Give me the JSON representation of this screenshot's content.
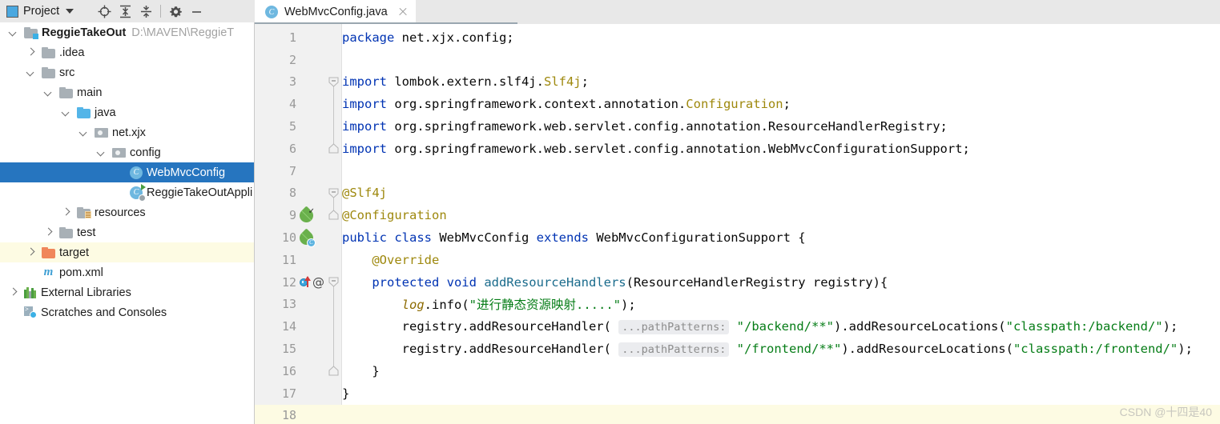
{
  "project_panel": {
    "title": "Project",
    "icons": [
      "project-square-icon",
      "chevron-down-icon",
      "locate-target-icon",
      "expand-all-icon",
      "collapse-all-icon",
      "gear-icon",
      "minimize-icon"
    ],
    "tree": [
      {
        "label": "ReggieTakeOut",
        "path": "D:\\MAVEN\\ReggieT",
        "icon": "folder-module-icon",
        "arrow": "down",
        "indent": 0,
        "bold": true,
        "state": "normal"
      },
      {
        "label": ".idea",
        "path": "",
        "icon": "folder-icon",
        "arrow": "right",
        "indent": 1,
        "bold": false,
        "state": "normal"
      },
      {
        "label": "src",
        "path": "",
        "icon": "folder-icon",
        "arrow": "down",
        "indent": 1,
        "bold": false,
        "state": "normal"
      },
      {
        "label": "main",
        "path": "",
        "icon": "folder-icon",
        "arrow": "down",
        "indent": 2,
        "bold": false,
        "state": "normal"
      },
      {
        "label": "java",
        "path": "",
        "icon": "folder-source-icon",
        "arrow": "down",
        "indent": 3,
        "bold": false,
        "state": "normal"
      },
      {
        "label": "net.xjx",
        "path": "",
        "icon": "package-icon",
        "arrow": "down",
        "indent": 4,
        "bold": false,
        "state": "normal"
      },
      {
        "label": "config",
        "path": "",
        "icon": "package-icon",
        "arrow": "down",
        "indent": 5,
        "bold": false,
        "state": "normal"
      },
      {
        "label": "WebMvcConfig",
        "path": "",
        "icon": "java-class-icon",
        "arrow": "none",
        "indent": 6,
        "bold": false,
        "state": "selected"
      },
      {
        "label": "ReggieTakeOutAppli",
        "path": "",
        "icon": "java-runnable-class-icon",
        "arrow": "none",
        "indent": 6,
        "bold": false,
        "state": "normal"
      },
      {
        "label": "resources",
        "path": "",
        "icon": "folder-resources-icon",
        "arrow": "right",
        "indent": 3,
        "bold": false,
        "state": "normal"
      },
      {
        "label": "test",
        "path": "",
        "icon": "folder-icon",
        "arrow": "right",
        "indent": 2,
        "bold": false,
        "state": "normal"
      },
      {
        "label": "target",
        "path": "",
        "icon": "folder-excluded-icon",
        "arrow": "right",
        "indent": 1,
        "bold": false,
        "state": "highlighted"
      },
      {
        "label": "pom.xml",
        "path": "",
        "icon": "maven-icon",
        "arrow": "none",
        "indent": 1,
        "bold": false,
        "state": "normal"
      },
      {
        "label": "External Libraries",
        "path": "",
        "icon": "libraries-icon",
        "arrow": "right",
        "indent": 0,
        "bold": false,
        "state": "normal"
      },
      {
        "label": "Scratches and Consoles",
        "path": "",
        "icon": "scratches-icon",
        "arrow": "none",
        "indent": 0,
        "bold": false,
        "state": "normal"
      }
    ]
  },
  "editor": {
    "tab": {
      "label": "WebMvcConfig.java",
      "icon": "java-class-icon",
      "close_icon": "close-icon"
    },
    "current_line": 18,
    "lines": [
      {
        "num": "1",
        "gutter": [],
        "fold": "none",
        "tokens": [
          {
            "t": "package ",
            "c": "kw"
          },
          {
            "t": "net.xjx.config;",
            "c": ""
          }
        ]
      },
      {
        "num": "2",
        "gutter": [],
        "fold": "none",
        "tokens": []
      },
      {
        "num": "3",
        "gutter": [],
        "fold": "start",
        "tokens": [
          {
            "t": "import ",
            "c": "kw"
          },
          {
            "t": "lombok.extern.slf4j.",
            "c": ""
          },
          {
            "t": "Slf4j",
            "c": "ann"
          },
          {
            "t": ";",
            "c": ""
          }
        ]
      },
      {
        "num": "4",
        "gutter": [],
        "fold": "mid",
        "tokens": [
          {
            "t": "import ",
            "c": "kw"
          },
          {
            "t": "org.springframework.context.annotation.",
            "c": ""
          },
          {
            "t": "Configuration",
            "c": "ann"
          },
          {
            "t": ";",
            "c": ""
          }
        ]
      },
      {
        "num": "5",
        "gutter": [],
        "fold": "mid",
        "tokens": [
          {
            "t": "import ",
            "c": "kw"
          },
          {
            "t": "org.springframework.web.servlet.config.annotation.ResourceHandlerRegistry;",
            "c": ""
          }
        ]
      },
      {
        "num": "6",
        "gutter": [],
        "fold": "end",
        "tokens": [
          {
            "t": "import ",
            "c": "kw"
          },
          {
            "t": "org.springframework.web.servlet.config.annotation.WebMvcConfigurationSupport;",
            "c": ""
          }
        ]
      },
      {
        "num": "7",
        "gutter": [],
        "fold": "none",
        "tokens": []
      },
      {
        "num": "8",
        "gutter": [],
        "fold": "start",
        "tokens": [
          {
            "t": "@Slf4j",
            "c": "ann"
          }
        ]
      },
      {
        "num": "9",
        "gutter": [
          "spring-bean-check-icon"
        ],
        "fold": "end",
        "tokens": [
          {
            "t": "@Configuration",
            "c": "ann"
          }
        ]
      },
      {
        "num": "10",
        "gutter": [
          "spring-bean-class-icon"
        ],
        "fold": "none",
        "tokens": [
          {
            "t": "public class ",
            "c": "kw"
          },
          {
            "t": "WebMvcConfig ",
            "c": ""
          },
          {
            "t": "extends ",
            "c": "kw"
          },
          {
            "t": "WebMvcConfigurationSupport {",
            "c": ""
          }
        ]
      },
      {
        "num": "11",
        "gutter": [],
        "fold": "none",
        "tokens": [
          {
            "t": "    @Override",
            "c": "ann"
          }
        ]
      },
      {
        "num": "12",
        "gutter": [
          "override-method-icon",
          "annotation-at-icon"
        ],
        "fold": "start",
        "tokens": [
          {
            "t": "    ",
            "c": ""
          },
          {
            "t": "protected void ",
            "c": "kw"
          },
          {
            "t": "addResourceHandlers",
            "c": "fn"
          },
          {
            "t": "(ResourceHandlerRegistry registry){",
            "c": ""
          }
        ]
      },
      {
        "num": "13",
        "gutter": [],
        "fold": "mid",
        "tokens": [
          {
            "t": "        ",
            "c": ""
          },
          {
            "t": "log",
            "c": "fld-i"
          },
          {
            "t": ".info(",
            "c": ""
          },
          {
            "t": "\"进行静态资源映射.....\"",
            "c": "str"
          },
          {
            "t": ");",
            "c": ""
          }
        ]
      },
      {
        "num": "14",
        "gutter": [],
        "fold": "mid",
        "tokens": [
          {
            "t": "        registry.addResourceHandler( ",
            "c": ""
          },
          {
            "t": "...pathPatterns:",
            "c": "hint"
          },
          {
            "t": " ",
            "c": ""
          },
          {
            "t": "\"/backend/**\"",
            "c": "str"
          },
          {
            "t": ").addResourceLocations(",
            "c": ""
          },
          {
            "t": "\"classpath:/backend/\"",
            "c": "str"
          },
          {
            "t": ");",
            "c": ""
          }
        ]
      },
      {
        "num": "15",
        "gutter": [],
        "fold": "mid",
        "tokens": [
          {
            "t": "        registry.addResourceHandler( ",
            "c": ""
          },
          {
            "t": "...pathPatterns:",
            "c": "hint"
          },
          {
            "t": " ",
            "c": ""
          },
          {
            "t": "\"/frontend/**\"",
            "c": "str"
          },
          {
            "t": ").addResourceLocations(",
            "c": ""
          },
          {
            "t": "\"classpath:/frontend/\"",
            "c": "str"
          },
          {
            "t": ");",
            "c": ""
          }
        ]
      },
      {
        "num": "16",
        "gutter": [],
        "fold": "end",
        "tokens": [
          {
            "t": "    }",
            "c": ""
          }
        ]
      },
      {
        "num": "17",
        "gutter": [],
        "fold": "none",
        "tokens": [
          {
            "t": "}",
            "c": ""
          }
        ]
      },
      {
        "num": "18",
        "gutter": [],
        "fold": "none",
        "tokens": []
      }
    ]
  },
  "watermark": "CSDN @十四是40",
  "colors": {
    "selection_blue": "#2675bf",
    "keyword_blue": "#0033b3",
    "string_green": "#067d17",
    "annotation_gold": "#9e880d",
    "method_teal": "#1a6b8c",
    "current_line_cream": "#fdfbe3"
  }
}
